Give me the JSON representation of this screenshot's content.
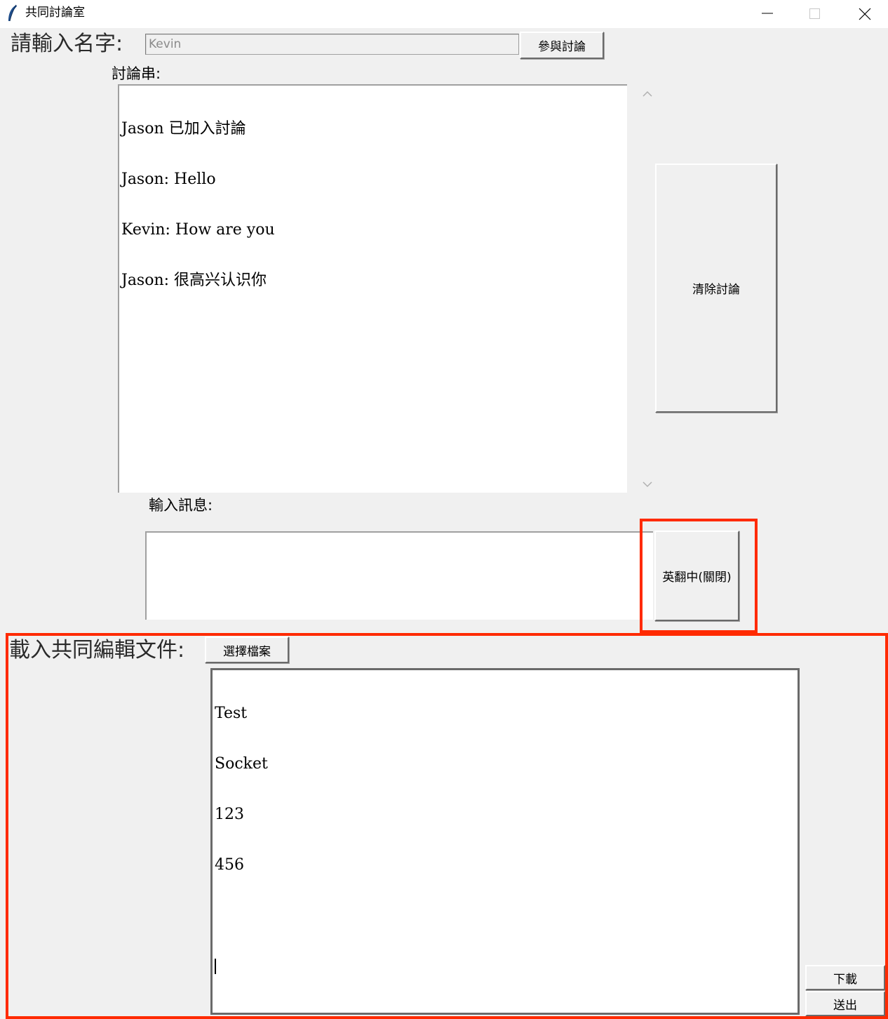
{
  "window": {
    "title": "共同討論室"
  },
  "name_row": {
    "label": "請輸入名字:",
    "name_value": "Kevin",
    "join_button": "參與討論"
  },
  "discussion": {
    "label": "討論串:",
    "messages": [
      "Jason 已加入討論",
      "Jason: Hello",
      "Kevin: How are you",
      "Jason: 很高兴认识你"
    ],
    "clear_button": "清除討論"
  },
  "message_input": {
    "label": "輸入訊息:",
    "value": "",
    "translate_button": "英翻中(關閉)"
  },
  "shared_doc": {
    "label": "載入共同編輯文件:",
    "choose_file_button": "選擇檔案",
    "lines": [
      "Test",
      "Socket",
      "123",
      "456",
      ""
    ],
    "download_button": "下載",
    "send_button": "送出"
  },
  "colors": {
    "highlight": "#ff2a00",
    "background": "#f0f0f0"
  }
}
